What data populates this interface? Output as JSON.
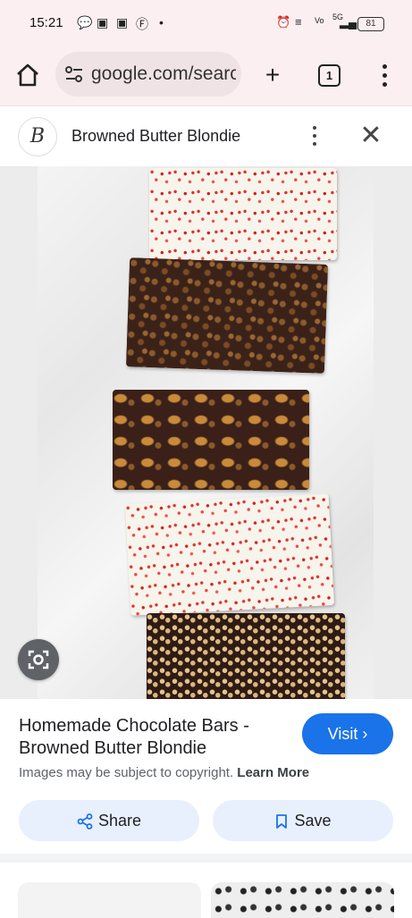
{
  "status_bar": {
    "time": "15:21",
    "notification_icons": [
      "chat-icon",
      "instagram-icon",
      "instagram-icon",
      "facebook-icon",
      "dot-icon"
    ],
    "network": "5G",
    "battery": "81"
  },
  "browser": {
    "url": "google.com/search",
    "tab_count": "1"
  },
  "result_header": {
    "site_name": "Browned Butter Blondie"
  },
  "image": {
    "alt": "Homemade Chocolate Bars"
  },
  "result": {
    "title": "Homemade Chocolate Bars - Browned Butter Blondie",
    "visit_label": "Visit",
    "copyright_text": "Images may be subject to copyright.",
    "learn_more": "Learn More",
    "share_label": "Share",
    "save_label": "Save"
  },
  "colors": {
    "accent": "#1a73e8",
    "pill_bg": "#e8f0fe",
    "status_bg": "#fbeff1"
  }
}
